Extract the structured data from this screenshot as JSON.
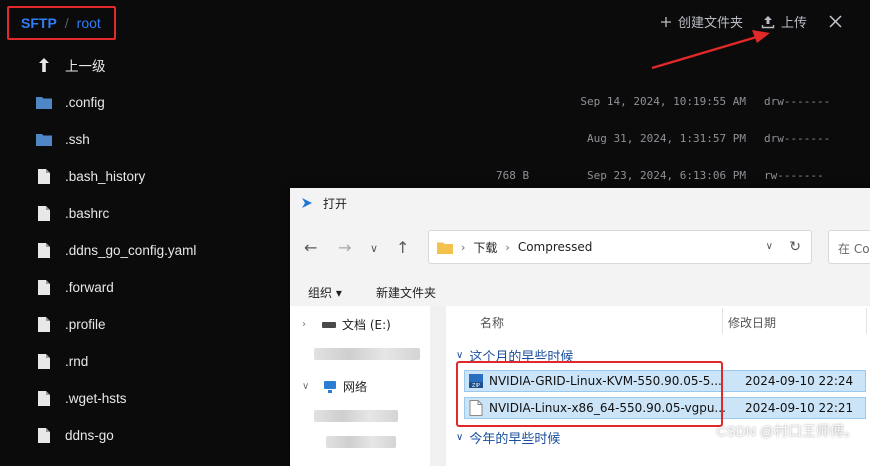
{
  "sftp": {
    "breadcrumb": {
      "root_label": "SFTP",
      "separator": "/",
      "path": "root"
    },
    "toolbar": {
      "new_folder_label": "创建文件夹",
      "upload_label": "上传"
    },
    "up_label": "上一级",
    "files": [
      {
        "name": ".config",
        "type": "folder",
        "size": "",
        "modified": "Sep 14, 2024, 10:19:55 AM",
        "perms": "drw-------"
      },
      {
        "name": ".ssh",
        "type": "folder",
        "size": "",
        "modified": "Aug 31, 2024, 1:31:57 PM",
        "perms": "drw-------"
      },
      {
        "name": ".bash_history",
        "type": "file",
        "size": "768 B",
        "modified": "Sep 23, 2024, 6:13:06 PM",
        "perms": "rw-------"
      },
      {
        "name": ".bashrc",
        "type": "file"
      },
      {
        "name": ".ddns_go_config.yaml",
        "type": "file"
      },
      {
        "name": ".forward",
        "type": "file"
      },
      {
        "name": ".profile",
        "type": "file"
      },
      {
        "name": ".rnd",
        "type": "file"
      },
      {
        "name": ".wget-hsts",
        "type": "file"
      },
      {
        "name": "ddns-go",
        "type": "file"
      }
    ]
  },
  "dialog": {
    "title": "打开",
    "address": {
      "segments": [
        "下载",
        "Compressed"
      ]
    },
    "search_placeholder": "在 Co",
    "commands": {
      "organize": "组织 ▾",
      "new_folder": "新建文件夹"
    },
    "nav_tree": [
      {
        "label": "文档 (E:)"
      },
      {
        "label": "网络"
      }
    ],
    "columns": {
      "name": "名称",
      "modified": "修改日期"
    },
    "groups": [
      {
        "label": "这个月的早些时候"
      },
      {
        "label": "今年的早些时候"
      }
    ],
    "files": [
      {
        "name": "NVIDIA-GRID-Linux-KVM-550.90.05-5...",
        "modified": "2024-09-10 22:24",
        "icon": "zip-icon"
      },
      {
        "name": "NVIDIA-Linux-x86_64-550.90.05-vgpu...",
        "modified": "2024-09-10 22:21",
        "icon": "file-icon"
      }
    ]
  },
  "watermark": "CSDN @村口王师傅。",
  "colors": {
    "accent": "#2f7df7",
    "highlight": "#e3282a",
    "selection": "#cce4f7"
  }
}
